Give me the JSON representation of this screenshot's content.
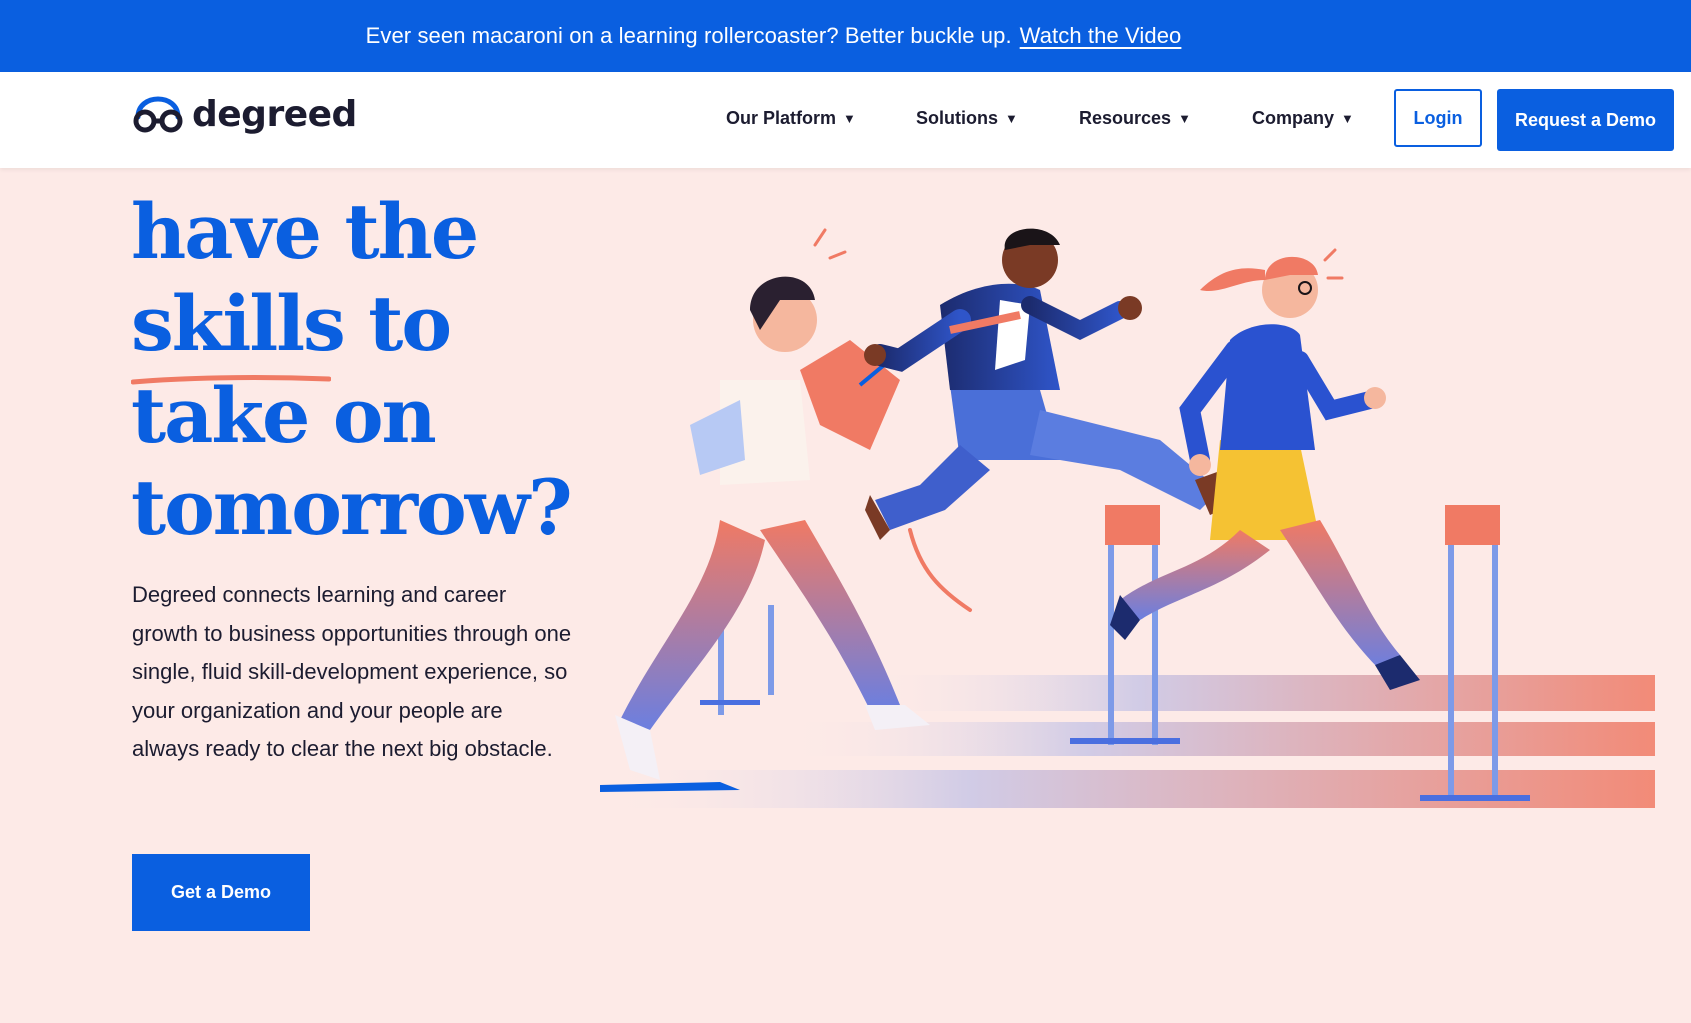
{
  "announcement": {
    "message": "Ever seen macaroni on a learning rollercoaster? Better buckle up.",
    "link_label": "Watch the Video"
  },
  "header": {
    "logo_text": "degreed",
    "logo_icon": "glasses-icon",
    "nav": [
      {
        "label": "Our Platform",
        "caret": "▼"
      },
      {
        "label": "Solutions",
        "caret": "▼"
      },
      {
        "label": "Resources",
        "caret": "▼"
      },
      {
        "label": "Company",
        "caret": "▼"
      }
    ],
    "login_label": "Login",
    "request_demo_label": "Request a Demo"
  },
  "hero": {
    "headline_lines": [
      "have the",
      "skills to",
      "take on",
      "tomorrow?"
    ],
    "body": "Degreed connects learning and career growth to business opportunities through one single, fluid skill-development experience, so your organization and your people are always ready to clear the next big obstacle.",
    "cta_label": "Get a Demo",
    "illustration": "hurdle-runners-illustration"
  },
  "colors": {
    "brand_blue": "#0a5fe0",
    "hero_background": "#fdeae7",
    "accent_coral": "#f07a64",
    "accent_yellow": "#f5c233",
    "text_dark": "#1c1c30"
  }
}
